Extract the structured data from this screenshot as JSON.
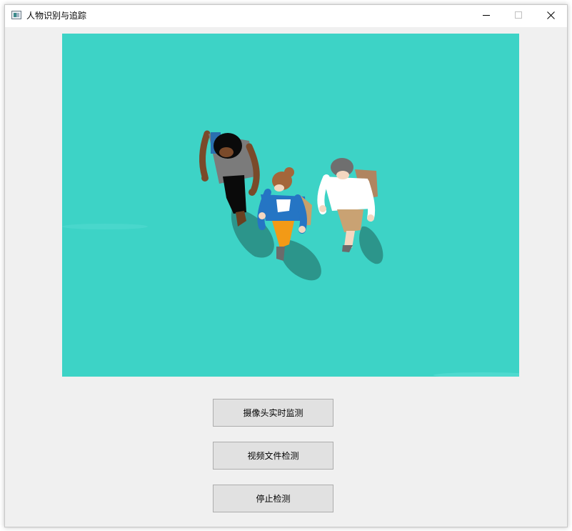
{
  "window": {
    "title": "人物识别与追踪",
    "icon": "app-window-icon",
    "controls": [
      "minimize-icon",
      "maximize-icon",
      "close-icon"
    ]
  },
  "display": {
    "content": "illustration of three people walking, top-down view",
    "background_color": "#3dd3c6"
  },
  "buttons": {
    "camera_label": "摄像头实时监测",
    "video_label": "视频文件检测",
    "stop_label": "停止检测"
  }
}
